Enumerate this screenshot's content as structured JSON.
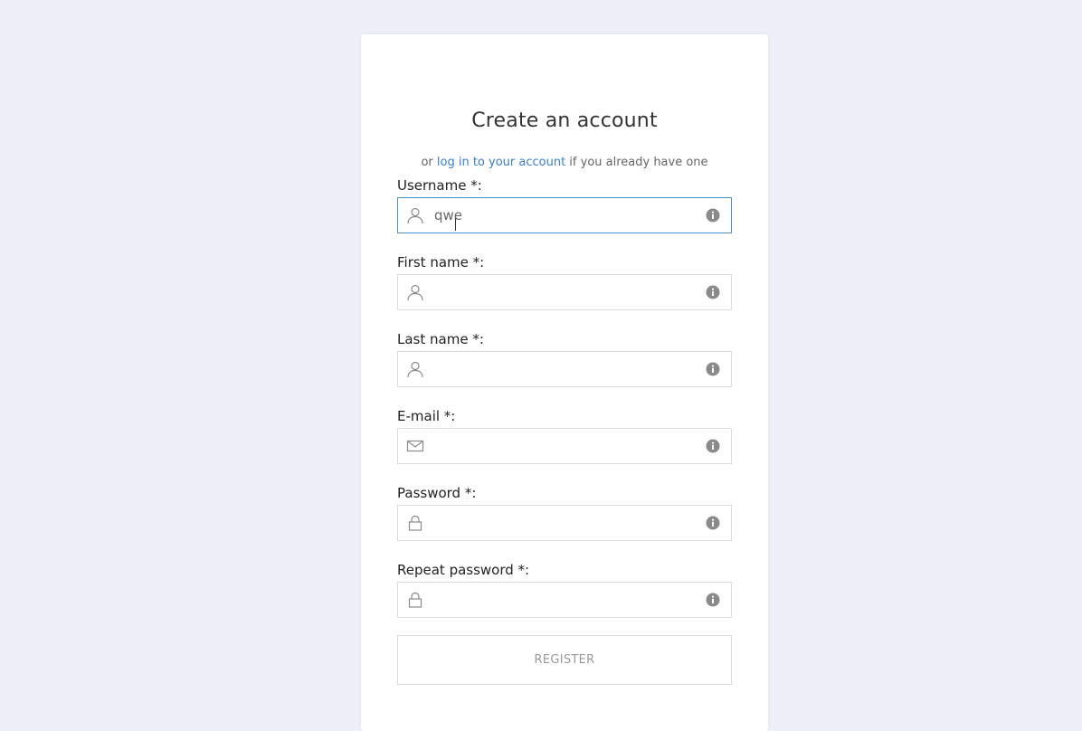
{
  "form": {
    "title": "Create an account",
    "subtitle_prefix": "or ",
    "login_link": "log in to your account",
    "subtitle_suffix": " if you already have one",
    "fields": [
      {
        "label": "Username *:",
        "value": "qwe",
        "placeholder": "",
        "icon": "user-icon"
      },
      {
        "label": "First name *:",
        "value": "",
        "placeholder": "",
        "icon": "user-icon"
      },
      {
        "label": "Last name *:",
        "value": "",
        "placeholder": "",
        "icon": "user-icon"
      },
      {
        "label": "E-mail *:",
        "value": "",
        "placeholder": "",
        "icon": "envelope-icon"
      },
      {
        "label": "Password *:",
        "value": "",
        "placeholder": "",
        "icon": "lock-icon"
      },
      {
        "label": "Repeat password *:",
        "value": "",
        "placeholder": "",
        "icon": "lock-icon"
      }
    ],
    "register_label": "REGISTER"
  },
  "colors": {
    "background": "#eef0f8",
    "link": "#3b7ec9",
    "focus_border": "#4a8fd6",
    "icon_gray": "#8a8a8a"
  }
}
